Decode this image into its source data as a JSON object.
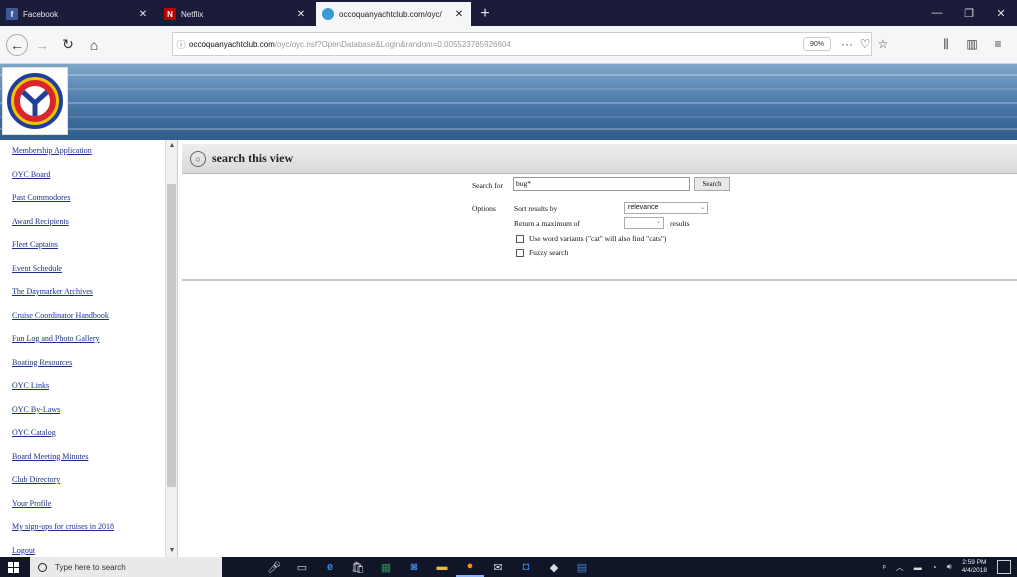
{
  "browser": {
    "tabs": [
      {
        "title": "Facebook",
        "favicon": "facebook-icon",
        "active": false
      },
      {
        "title": "Netflix",
        "favicon": "netflix-icon",
        "active": false
      },
      {
        "title": "occoquanyachtclub.com/oyc/",
        "favicon": "website-icon",
        "active": true
      }
    ],
    "new_tab": "+",
    "url_host": "occoquanyachtclub.com",
    "url_path": "/oyc/oyc.nsf?OpenDatabase&Login&random=0.005523765926604",
    "zoom": "90%"
  },
  "sidebar": {
    "items": [
      "Membership Application",
      "OYC Board",
      "Past Commodores",
      "Award Recipients",
      "Fleet Captains",
      "Event Schedule",
      "The Daymarker Archives",
      "Cruise Coordinator Handbook",
      "Fun Log and Photo Gallery",
      "Boating Resources",
      "OYC Links",
      "OYC By-Laws",
      "OYC Catalog",
      "Board Meeting Minutes",
      "Club Directory",
      "Your Profile",
      "My sign-ups for cruises in 2018",
      "Logout"
    ]
  },
  "search": {
    "header_title": "search this view",
    "search_for_label": "Search for",
    "query": "bug*",
    "search_button": "Search",
    "options_label": "Options",
    "sort_label": "Sort results by",
    "sort_value": "relevance",
    "return_max_label": "Return a maximum of",
    "results_label": "results",
    "word_variants_label": "Use word variants (\"cat\" will also find \"cats\")",
    "fuzzy_label": "Fuzzy search"
  },
  "taskbar": {
    "search_placeholder": "Type here to search",
    "time": "2:59 PM",
    "date": "4/4/2018"
  },
  "colors": {
    "link": "#1a2f8a",
    "tabstrip": "#1b1b3a",
    "taskbar": "#101628"
  }
}
